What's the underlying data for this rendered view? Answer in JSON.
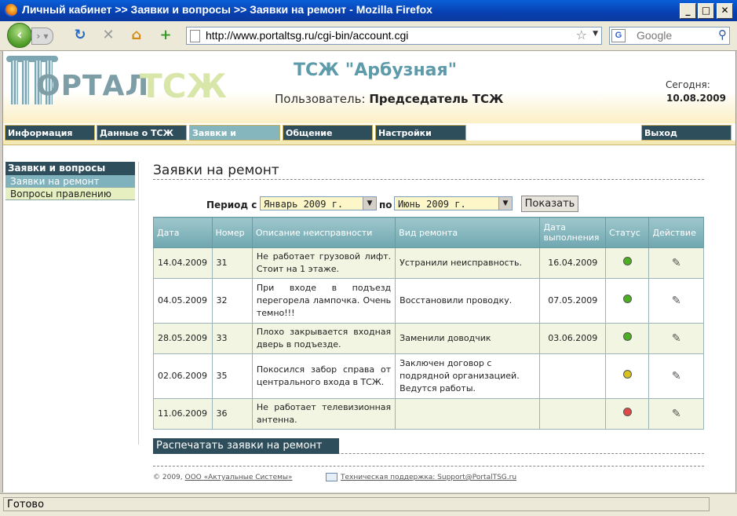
{
  "browser": {
    "window_title": "Личный кабинет >> Заявки и вопросы >> Заявки на ремонт - Mozilla Firefox",
    "url": "http://www.portaltsg.ru/cgi-bin/account.cgi",
    "search_placeholder": "Google",
    "status": "Готово",
    "window_buttons": [
      "_",
      "□",
      "✕"
    ]
  },
  "header": {
    "logo_text": "ОРТАЛ",
    "logo_accent": "ТСЖ",
    "site_title": "ТСЖ \"Арбузная\"",
    "user_label": "Пользователь:",
    "user_name": "Председатель ТСЖ",
    "today_label": "Сегодня:",
    "today_value": "10.08.2009"
  },
  "menu": [
    {
      "label": "Информация"
    },
    {
      "label": "Данные о ТСЖ"
    },
    {
      "label": "Заявки и вопросы"
    },
    {
      "label": "Общение"
    },
    {
      "label": "Настройки"
    },
    {
      "label": "Выход"
    }
  ],
  "sidebar": {
    "heading": "Заявки и вопросы",
    "items": [
      {
        "label": "Заявки на ремонт"
      },
      {
        "label": "Вопросы правлению"
      }
    ]
  },
  "main": {
    "title": "Заявки на ремонт",
    "period_label": "Период с",
    "period_from": "Январь 2009 г.",
    "period_to_label": "по",
    "period_to": "Июнь 2009 г.",
    "show_button": "Показать",
    "print_button": "Распечатать заявки на ремонт"
  },
  "table": {
    "headers": [
      "Дата",
      "Номер",
      "Описание неисправности",
      "Вид ремонта",
      "Дата выполнения",
      "Статус",
      "Действие"
    ],
    "rows": [
      {
        "date": "14.04.2009",
        "number": "31",
        "description": "Не работает грузовой лифт. Стоит на 1 этаже.",
        "repair": "Устранили неисправность.",
        "done": "16.04.2009",
        "status_color": "#4caf1e"
      },
      {
        "date": "04.05.2009",
        "number": "32",
        "description": "При входе в подъезд перегорела лампочка. Очень темно!!!",
        "repair": "Восстановили проводку.",
        "done": "07.05.2009",
        "status_color": "#4caf1e"
      },
      {
        "date": "28.05.2009",
        "number": "33",
        "description": "Плохо закрывается входная дверь в подъезде.",
        "repair": "Заменили доводчик",
        "done": "03.06.2009",
        "status_color": "#4caf1e"
      },
      {
        "date": "02.06.2009",
        "number": "35",
        "description": "Покосился забор справа от центрального входа в ТСЖ.",
        "repair": "Заключен договор с подрядной организацией. Ведутся работы.",
        "done": "",
        "status_color": "#d6c21a"
      },
      {
        "date": "11.06.2009",
        "number": "36",
        "description": "Не работает телевизионная антенна.",
        "repair": "",
        "done": "",
        "status_color": "#e04848"
      }
    ]
  },
  "footer": {
    "copyright_prefix": "© 2009,",
    "company": "ООО «Актуальные Системы»",
    "support": "Техническая поддержка: Support@PortalTSG.ru"
  }
}
